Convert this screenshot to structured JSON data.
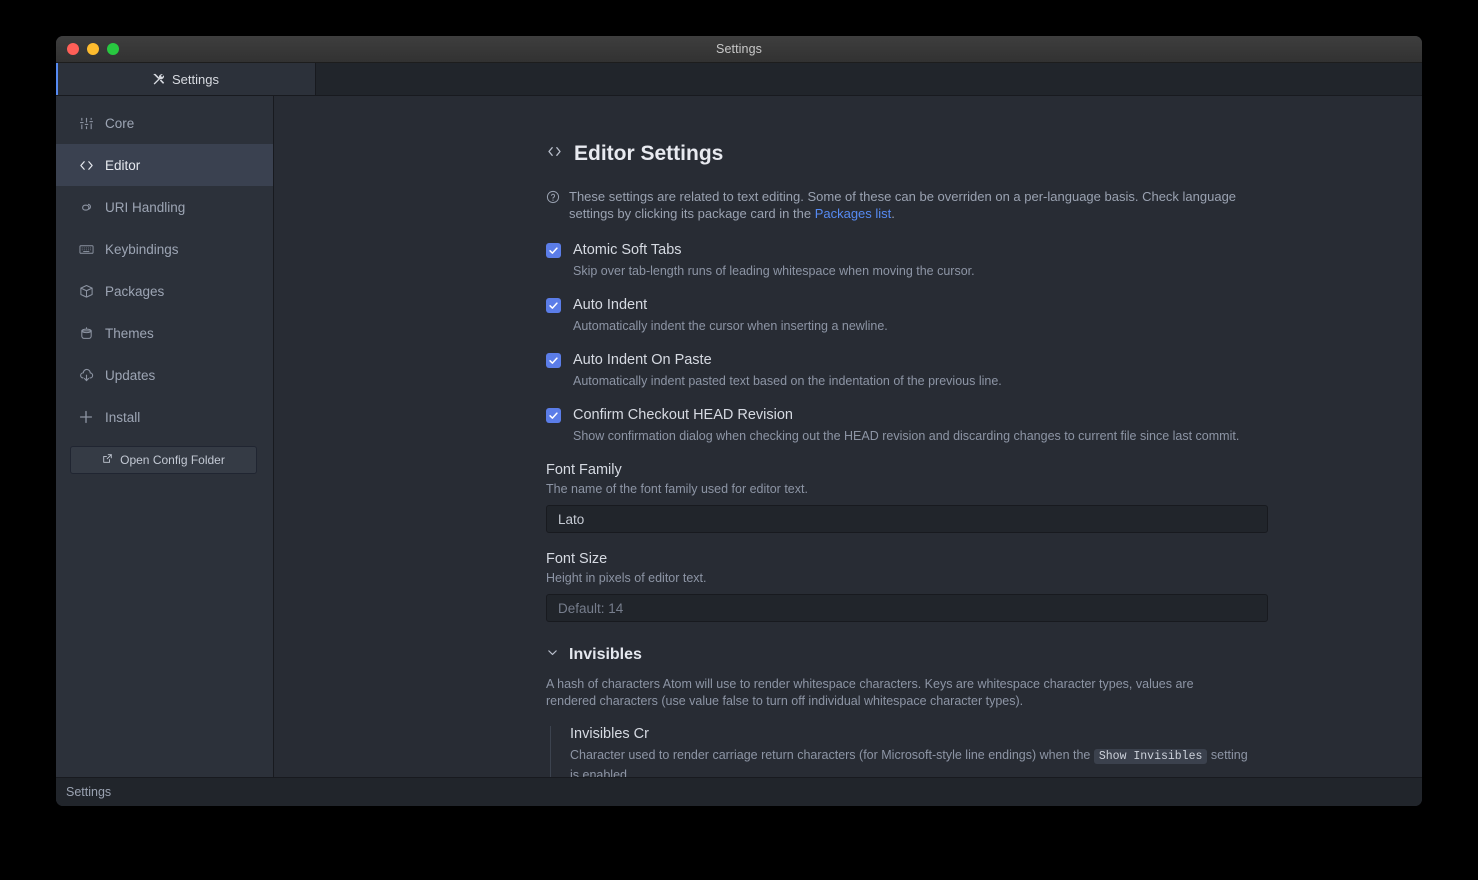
{
  "window": {
    "title": "Settings",
    "traffic_lights": [
      "close",
      "minimize",
      "zoom"
    ]
  },
  "tabbar": {
    "tabs": [
      {
        "label": "Settings",
        "icon": "tools-icon",
        "active": true
      }
    ]
  },
  "sidebar": {
    "items": [
      {
        "label": "Core",
        "icon": "sliders-icon",
        "active": false
      },
      {
        "label": "Editor",
        "icon": "code-icon",
        "active": true
      },
      {
        "label": "URI Handling",
        "icon": "link-icon",
        "active": false
      },
      {
        "label": "Keybindings",
        "icon": "keyboard-icon",
        "active": false
      },
      {
        "label": "Packages",
        "icon": "package-icon",
        "active": false
      },
      {
        "label": "Themes",
        "icon": "paintbucket-icon",
        "active": false
      },
      {
        "label": "Updates",
        "icon": "cloud-download-icon",
        "active": false
      },
      {
        "label": "Install",
        "icon": "plus-icon",
        "active": false
      }
    ],
    "config_button": {
      "label": "Open Config Folder",
      "icon": "external-link-icon"
    }
  },
  "main": {
    "title": "Editor Settings",
    "title_icon": "code-icon",
    "note": {
      "icon": "question-icon",
      "text_before": "These settings are related to text editing. Some of these can be overriden on a per-language basis. Check language settings by clicking its package card in the ",
      "link_text": "Packages list",
      "text_after": "."
    },
    "checkbox_settings": [
      {
        "label": "Atomic Soft Tabs",
        "description": "Skip over tab-length runs of leading whitespace when moving the cursor.",
        "checked": true
      },
      {
        "label": "Auto Indent",
        "description": "Automatically indent the cursor when inserting a newline.",
        "checked": true
      },
      {
        "label": "Auto Indent On Paste",
        "description": "Automatically indent pasted text based on the indentation of the previous line.",
        "checked": true
      },
      {
        "label": "Confirm Checkout HEAD Revision",
        "description": "Show confirmation dialog when checking out the HEAD revision and discarding changes to current file since last commit.",
        "checked": true
      }
    ],
    "font_family": {
      "label": "Font Family",
      "description": "The name of the font family used for editor text.",
      "value": "Lato",
      "placeholder": ""
    },
    "font_size": {
      "label": "Font Size",
      "description": "Height in pixels of editor text.",
      "value": "",
      "placeholder": "Default: 14"
    },
    "invisibles_section": {
      "title": "Invisibles",
      "chevron": "chevron-down-icon",
      "description": "A hash of characters Atom will use to render whitespace characters. Keys are whitespace character types, values are rendered characters (use value false to turn off individual whitespace character types).",
      "sub_setting": {
        "label": "Invisibles Cr",
        "desc_before": "Character used to render carriage return characters (for Microsoft-style line endings) when the ",
        "code": "Show Invisibles",
        "desc_after": " setting is enabled."
      }
    }
  },
  "statusbar": {
    "label": "Settings"
  },
  "colors": {
    "accent": "#568af2",
    "checkbox": "#5b7de8",
    "link": "#568af2",
    "sidebar_bg": "#2c313a",
    "main_bg": "#282c34",
    "chrome_bg": "#21252b"
  }
}
